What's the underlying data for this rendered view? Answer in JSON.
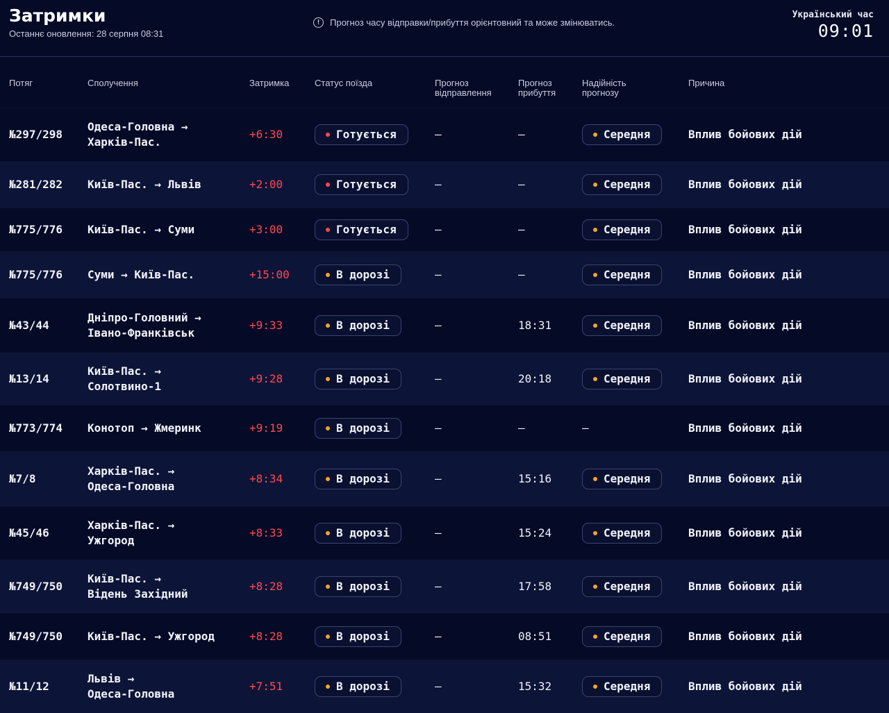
{
  "header": {
    "title": "Затримки",
    "updated": "Останнє оновлення: 28 серпня 08:31",
    "notice": "Прогноз часу відправки/прибуття орієнтовний та може змінюватись.",
    "clock_label": "Український час",
    "clock": "09:01"
  },
  "colors": {
    "delay": "#ff4a4f",
    "status_preparing_dot": "#ff4a4f",
    "status_enroute_dot": "#f5a623",
    "reliability_dot": "#f5a623"
  },
  "columns": {
    "train": "Потяг",
    "route": "Сполучення",
    "delay": "Затримка",
    "status": "Статус поїзда",
    "dep_l1": "Прогноз",
    "dep_l2": "відправлення",
    "arr_l1": "Прогноз",
    "arr_l2": "прибуття",
    "rel_l1": "Надійність",
    "rel_l2": "прогнозу",
    "reason": "Причина"
  },
  "rows": [
    {
      "train": "№297/298",
      "route1": "Одеса-Головна →",
      "route2": "Харків-Пас.",
      "delay": "+6:30",
      "status": "Готується",
      "status_type": "preparing",
      "dep": "—",
      "arr": "—",
      "reliability": "Середня",
      "reason": "Вплив бойових дій"
    },
    {
      "train": "№281/282",
      "route1": "Київ-Пас. → Львів",
      "route2": "",
      "delay": "+2:00",
      "status": "Готується",
      "status_type": "preparing",
      "dep": "—",
      "arr": "—",
      "reliability": "Середня",
      "reason": "Вплив бойових дій"
    },
    {
      "train": "№775/776",
      "route1": "Київ-Пас. → Суми",
      "route2": "",
      "delay": "+3:00",
      "status": "Готується",
      "status_type": "preparing",
      "dep": "—",
      "arr": "—",
      "reliability": "Середня",
      "reason": "Вплив бойових дій"
    },
    {
      "train": "№775/776",
      "route1": "Суми → Київ-Пас.",
      "route2": "",
      "delay": "+15:00",
      "status": "В дорозі",
      "status_type": "enroute",
      "dep": "—",
      "arr": "—",
      "reliability": "Середня",
      "reason": "Вплив бойових дій"
    },
    {
      "train": "№43/44",
      "route1": "Дніпро-Головний →",
      "route2": "Івано-Франківськ",
      "delay": "+9:33",
      "status": "В дорозі",
      "status_type": "enroute",
      "dep": "—",
      "arr": "18:31",
      "reliability": "Середня",
      "reason": "Вплив бойових дій"
    },
    {
      "train": "№13/14",
      "route1": "Київ-Пас. →",
      "route2": "Солотвино-1",
      "delay": "+9:28",
      "status": "В дорозі",
      "status_type": "enroute",
      "dep": "—",
      "arr": "20:18",
      "reliability": "Середня",
      "reason": "Вплив бойових дій"
    },
    {
      "train": "№773/774",
      "route1": "Конотоп → Жмеринк",
      "route2": "",
      "delay": "+9:19",
      "status": "В дорозі",
      "status_type": "enroute",
      "dep": "—",
      "arr": "—",
      "reliability": "—",
      "reason": "Вплив бойових дій"
    },
    {
      "train": "№7/8",
      "route1": "Харків-Пас. →",
      "route2": "Одеса-Головна",
      "delay": "+8:34",
      "status": "В дорозі",
      "status_type": "enroute",
      "dep": "—",
      "arr": "15:16",
      "reliability": "Середня",
      "reason": "Вплив бойових дій"
    },
    {
      "train": "№45/46",
      "route1": "Харків-Пас. →",
      "route2": "Ужгород",
      "delay": "+8:33",
      "status": "В дорозі",
      "status_type": "enroute",
      "dep": "—",
      "arr": "15:24",
      "reliability": "Середня",
      "reason": "Вплив бойових дій"
    },
    {
      "train": "№749/750",
      "route1": "Київ-Пас. →",
      "route2": "Відень Західний",
      "delay": "+8:28",
      "status": "В дорозі",
      "status_type": "enroute",
      "dep": "—",
      "arr": "17:58",
      "reliability": "Середня",
      "reason": "Вплив бойових дій"
    },
    {
      "train": "№749/750",
      "route1": "Київ-Пас. → Ужгород",
      "route2": "",
      "delay": "+8:28",
      "status": "В дорозі",
      "status_type": "enroute",
      "dep": "—",
      "arr": "08:51",
      "reliability": "Середня",
      "reason": "Вплив бойових дій"
    },
    {
      "train": "№11/12",
      "route1": "Львів →",
      "route2": "Одеса-Головна",
      "delay": "+7:51",
      "status": "В дорозі",
      "status_type": "enroute",
      "dep": "—",
      "arr": "15:32",
      "reliability": "Середня",
      "reason": "Вплив бойових дій"
    }
  ]
}
